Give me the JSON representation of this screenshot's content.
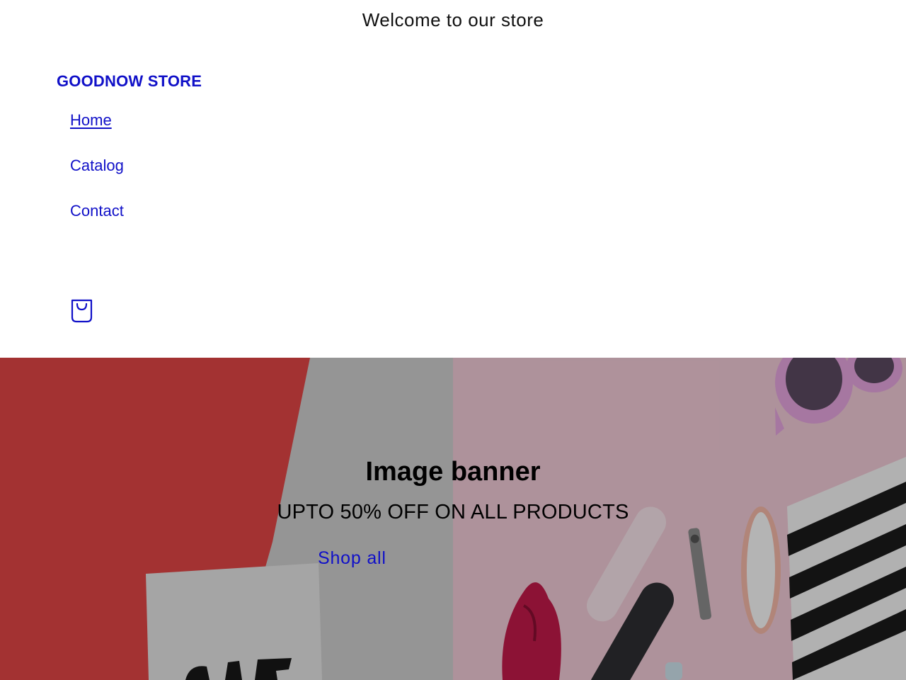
{
  "announcement": {
    "text": "Welcome to our store"
  },
  "header": {
    "brand": "GOODNOW STORE",
    "nav": [
      {
        "label": "Home",
        "active": true
      },
      {
        "label": "Catalog",
        "active": false
      },
      {
        "label": "Contact",
        "active": false
      }
    ],
    "cart_icon": "shopping-bag-icon"
  },
  "banner": {
    "title": "Image banner",
    "subtitle": "UPTO 50% OFF ON ALL PRODUCTS",
    "button_label": "Shop all"
  },
  "colors": {
    "link": "#1010c8",
    "text": "#111111",
    "background": "#ffffff"
  }
}
